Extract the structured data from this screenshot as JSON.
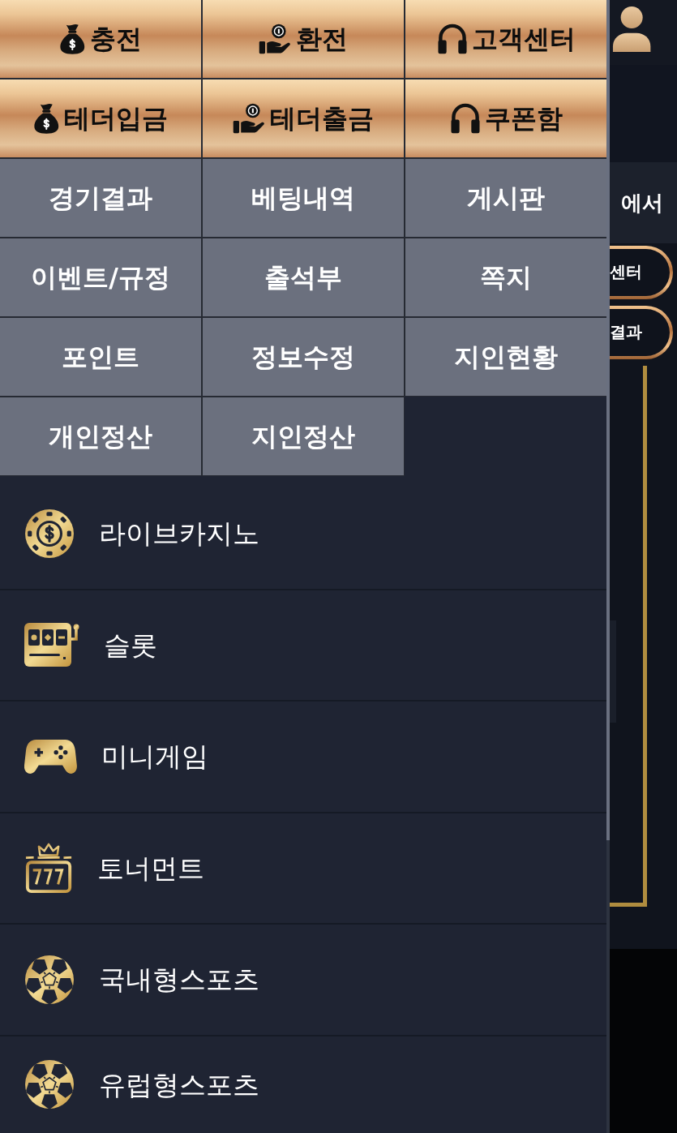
{
  "quick_buttons": [
    {
      "label": "충전",
      "kind": "deposit"
    },
    {
      "label": "환전",
      "kind": "withdraw"
    },
    {
      "label": "고객센터",
      "kind": "support"
    },
    {
      "label": "테더입금",
      "kind": "deposit"
    },
    {
      "label": "테더출금",
      "kind": "withdraw"
    },
    {
      "label": "쿠폰함",
      "kind": "support"
    }
  ],
  "menu_buttons": [
    "경기결과",
    "베팅내역",
    "게시판",
    "이벤트/규정",
    "출석부",
    "쪽지",
    "포인트",
    "정보수정",
    "지인현황",
    "개인정산",
    "지인정산"
  ],
  "game_menu": [
    {
      "label": "라이브카지노",
      "kind": "casino"
    },
    {
      "label": "슬롯",
      "kind": "slot"
    },
    {
      "label": "미니게임",
      "kind": "minigame"
    },
    {
      "label": "토너먼트",
      "kind": "tournament"
    },
    {
      "label": "국내형스포츠",
      "kind": "sports"
    },
    {
      "label": "유럽형스포츠",
      "kind": "sports"
    }
  ],
  "background_page": {
    "heading": "에서",
    "buttons": [
      "센터",
      "결과"
    ]
  }
}
